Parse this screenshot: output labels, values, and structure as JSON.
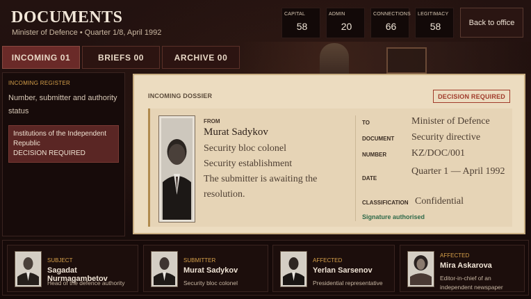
{
  "header": {
    "title": "DOCUMENTS",
    "subtitle": "Minister of Defence  •  Quarter 1/8, April 1992",
    "back_label": "Back to office"
  },
  "stats": [
    {
      "label": "CAPITAL",
      "value": "58"
    },
    {
      "label": "ADMIN",
      "value": "20"
    },
    {
      "label": "CONNECTIONS",
      "value": "66"
    },
    {
      "label": "LEGITIMACY",
      "value": "58"
    }
  ],
  "tabs": [
    {
      "label": "INCOMING  01",
      "active": true
    },
    {
      "label": "BRIEFS  00",
      "active": false
    },
    {
      "label": "ARCHIVE  00",
      "active": false
    }
  ],
  "register": {
    "heading": "INCOMING REGISTER",
    "description": "Number, submitter and authority status",
    "item_title": "Institutions of the Independent Republic",
    "item_status": "DECISION REQUIRED"
  },
  "dossier": {
    "heading": "INCOMING DOSSIER",
    "badge": "DECISION REQUIRED",
    "from_label": "FROM",
    "from_name": "Murat Sadykov",
    "from_lines": [
      "Security bloc colonel",
      "Security establishment",
      "The submitter is awaiting the",
      "resolution."
    ],
    "meta": [
      {
        "label": "TO",
        "value": "Minister of Defence"
      },
      {
        "label": "DOCUMENT",
        "value": "Security directive"
      },
      {
        "label": "NUMBER",
        "value": "KZ/DOC/001"
      },
      {
        "label": "DATE",
        "value": "Quarter 1 — April 1992"
      },
      {
        "label": "CLASSIFICATION",
        "value": "Confidential"
      }
    ],
    "signature": "Signature authorised"
  },
  "persons": [
    {
      "role": "SUBJECT",
      "name": "Sagadat Nurmagambetov",
      "desc": "Head of the defence authority"
    },
    {
      "role": "SUBMITTER",
      "name": "Murat Sadykov",
      "desc": "Security bloc colonel"
    },
    {
      "role": "AFFECTED",
      "name": "Yerlan Sarsenov",
      "desc": "Presidential representative"
    },
    {
      "role": "AFFECTED",
      "name": "Mira Askarova",
      "desc": "Editor-in-chief of an independent newspaper"
    }
  ]
}
